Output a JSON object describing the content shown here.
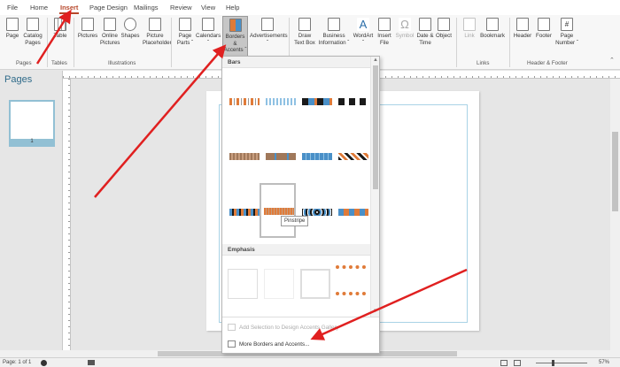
{
  "tabs": [
    "File",
    "Home",
    "Insert",
    "Page Design",
    "Mailings",
    "Review",
    "View",
    "Help"
  ],
  "active_tab": "Insert",
  "ribbon": {
    "page": [
      "Page",
      ""
    ],
    "catalog_pages": [
      "Catalog",
      "Pages"
    ],
    "table": [
      "Table",
      ""
    ],
    "pictures": [
      "Pictures",
      ""
    ],
    "online_pictures": [
      "Online",
      "Pictures"
    ],
    "shapes": [
      "Shapes",
      ""
    ],
    "picture_placeholder": [
      "Picture",
      "Placeholder"
    ],
    "page_parts": [
      "Page",
      "Parts ˇ"
    ],
    "calendars": [
      "Calendars",
      "ˇ"
    ],
    "borders_accents": [
      "Borders &",
      "Accents ˇ"
    ],
    "advertisements": [
      "Advertisements",
      "ˇ"
    ],
    "draw_text_box": [
      "Draw",
      "Text Box"
    ],
    "business_information": [
      "Business",
      "Information ˇ"
    ],
    "wordart": [
      "WordArt",
      "ˇ"
    ],
    "insert_file": [
      "Insert",
      "File"
    ],
    "symbol": [
      "Symbol",
      ""
    ],
    "date_time": [
      "Date &",
      "Time"
    ],
    "object": [
      "Object",
      ""
    ],
    "link": [
      "Link",
      ""
    ],
    "bookmark": [
      "Bookmark",
      ""
    ],
    "header": [
      "Header",
      ""
    ],
    "footer": [
      "Footer",
      ""
    ],
    "page_number": [
      "Page",
      "Number ˇ"
    ],
    "groups": {
      "pages": "Pages",
      "tables": "Tables",
      "illustrations": "Illustrations",
      "links": "Links",
      "header_footer": "Header & Footer"
    }
  },
  "pages_pane": {
    "title": "Pages",
    "thumb_number": "1"
  },
  "gallery": {
    "sections": [
      "Bars",
      "Emphasis"
    ],
    "tooltip": "Pinstripe",
    "menu": {
      "add_selection": "Add Selection to Design Accents Gallery",
      "more_borders": "More Borders and Accents..."
    },
    "colors": {
      "orange": "#e07b39",
      "blue": "#4a90c8",
      "black": "#1a1a1a",
      "brown": "#a0785a"
    }
  },
  "status": {
    "page": "Page: 1 of 1",
    "zoom": "57%"
  }
}
